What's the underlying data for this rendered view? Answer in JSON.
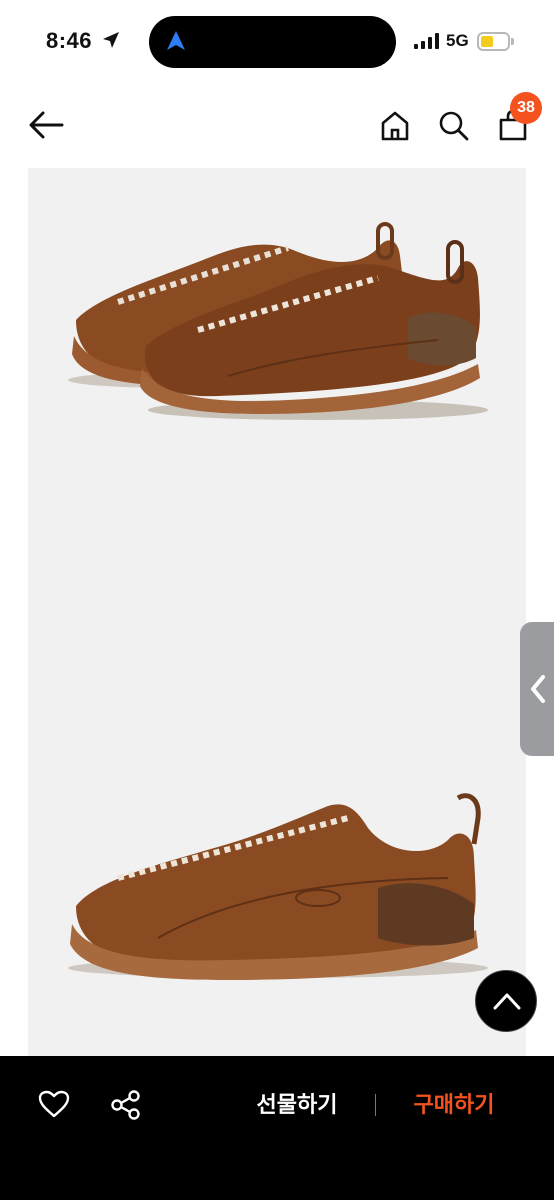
{
  "status_bar": {
    "time": "8:46",
    "network": "5G",
    "battery_color": "#f5cc1e"
  },
  "nav": {
    "back_icon": "arrow-left-icon",
    "home_icon": "home-icon",
    "search_icon": "search-icon",
    "cart_icon": "shopping-bag-icon",
    "cart_count": "38",
    "badge_color": "#f4531f"
  },
  "product": {
    "images": [
      "shoe-pair-image",
      "shoe-side-image"
    ]
  },
  "bottom_bar": {
    "wishlist_icon": "heart-icon",
    "share_icon": "share-icon",
    "gift_label": "선물하기",
    "buy_label": "구매하기",
    "buy_color": "#f4531f"
  },
  "controls": {
    "side_tab_icon": "chevron-left-icon",
    "scroll_top_icon": "chevron-up-icon"
  }
}
